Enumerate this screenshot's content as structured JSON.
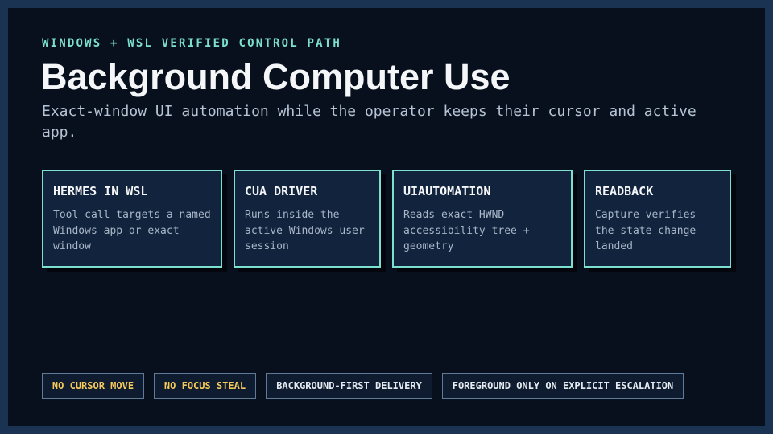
{
  "header": {
    "eyebrow": "WINDOWS + WSL VERIFIED CONTROL PATH",
    "title": "Background Computer Use",
    "subtitle": "Exact-window UI automation while the operator keeps their cursor and active app."
  },
  "cards": [
    {
      "title": "HERMES IN WSL",
      "description": "Tool call targets a named Windows app or exact window"
    },
    {
      "title": "CUA DRIVER",
      "description": "Runs inside the active Windows user session"
    },
    {
      "title": "UIAUTOMATION",
      "description": "Reads exact HWND accessibility tree + geometry"
    },
    {
      "title": "READBACK",
      "description": "Capture verifies the state change landed"
    }
  ],
  "tags": [
    {
      "label": "NO CURSOR MOVE",
      "color": "#f6c95b"
    },
    {
      "label": "NO FOCUS STEAL",
      "color": "#f6c95b"
    },
    {
      "label": "BACKGROUND-FIRST DELIVERY",
      "color": "#e6ebf1"
    },
    {
      "label": "FOREGROUND ONLY ON EXPLICIT ESCALATION",
      "color": "#e6ebf1"
    }
  ],
  "theme": {
    "accent": "#7de0cf",
    "background": "#08101d",
    "border": "#1b3353",
    "card_background": "#12233d",
    "warning": "#f6c95b"
  }
}
